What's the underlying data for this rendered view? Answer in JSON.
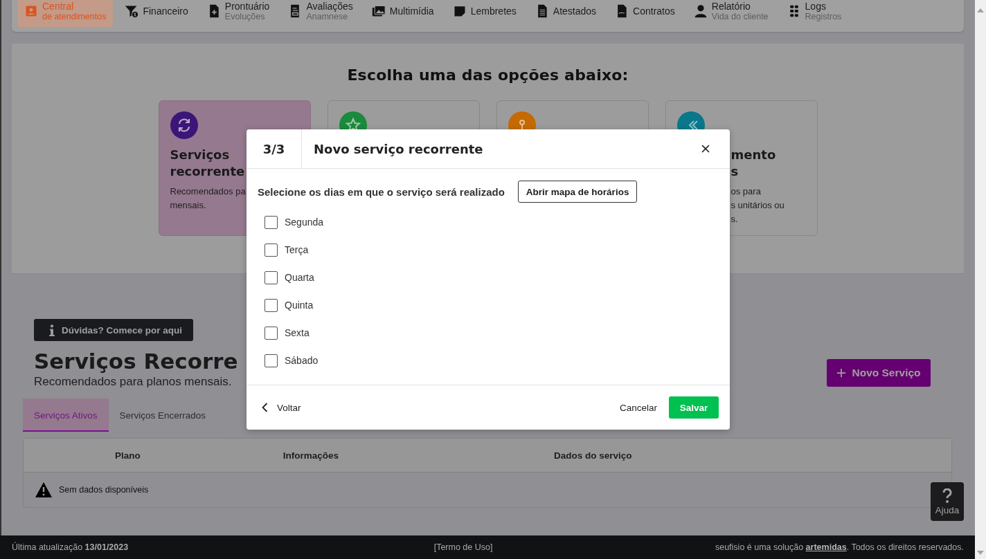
{
  "nav": [
    {
      "label": "Central",
      "sublabel": "de atendimentos",
      "selected": true
    },
    {
      "label": "Financeiro",
      "selected": false
    },
    {
      "label": "Prontuário",
      "sublabel": "Evoluções",
      "selected": false
    },
    {
      "label": "Avaliações",
      "sublabel": "Anamnese",
      "selected": false
    },
    {
      "label": "Multimídia",
      "selected": false
    },
    {
      "label": "Lembretes",
      "selected": false
    },
    {
      "label": "Atestados",
      "selected": false
    },
    {
      "label": "Contratos",
      "selected": false
    },
    {
      "label": "Relatório",
      "sublabel": "Vida do cliente",
      "selected": false
    },
    {
      "label": "Logs",
      "sublabel": "Registros",
      "selected": false
    }
  ],
  "options": {
    "title": "Escolha uma das opções abaixo:",
    "cards": [
      {
        "color": "#3b1678",
        "selected": true,
        "title_lines": [
          "Serviços",
          "recorrente"
        ],
        "desc_lines": [
          "Recomendados pa",
          "mensais."
        ]
      },
      {
        "color": "#1a8a3c",
        "selected": false
      },
      {
        "color": "#c46a00",
        "selected": false
      },
      {
        "color": "#08788a",
        "selected": false,
        "title_lines": [
          "mento",
          "s"
        ],
        "desc_lines": [
          "os para",
          "s unitários ou",
          "s."
        ]
      }
    ]
  },
  "help_banner": "Dúvidas? Comece por aqui",
  "section": {
    "title": "Serviços Recorre",
    "subtitle": "Recomendados para planos mensais."
  },
  "new_button": "Novo Serviço",
  "tabs": [
    {
      "label": "Serviços Ativos",
      "selected": true
    },
    {
      "label": "Serviços Encerrados",
      "selected": false
    }
  ],
  "table": {
    "columns": [
      "Plano",
      "Informações",
      "Dados do serviço"
    ],
    "empty_message": "Sem dados disponíveis"
  },
  "help_button": "Ajuda",
  "footer": {
    "last_update": "Última atualização **13/01/2023**",
    "terms": "[Termo de Uso]",
    "credits_before": "seufisio é uma solução ",
    "credits_link": "artemidas",
    "credits_after": ". Todos os direitos reservados."
  },
  "modal": {
    "step": "3/3",
    "title": "Novo serviço recorrente",
    "prompt": "Selecione os dias em que o serviço será realizado",
    "map_button": "Abrir mapa de horários",
    "days": [
      {
        "label": "Segunda",
        "checked": false
      },
      {
        "label": "Terça",
        "checked": false
      },
      {
        "label": "Quarta",
        "checked": false
      },
      {
        "label": "Quinta",
        "checked": false
      },
      {
        "label": "Sexta",
        "checked": false
      },
      {
        "label": "Sábado",
        "checked": false
      }
    ],
    "back": "Voltar",
    "cancel": "Cancelar",
    "save": "Salvar"
  }
}
